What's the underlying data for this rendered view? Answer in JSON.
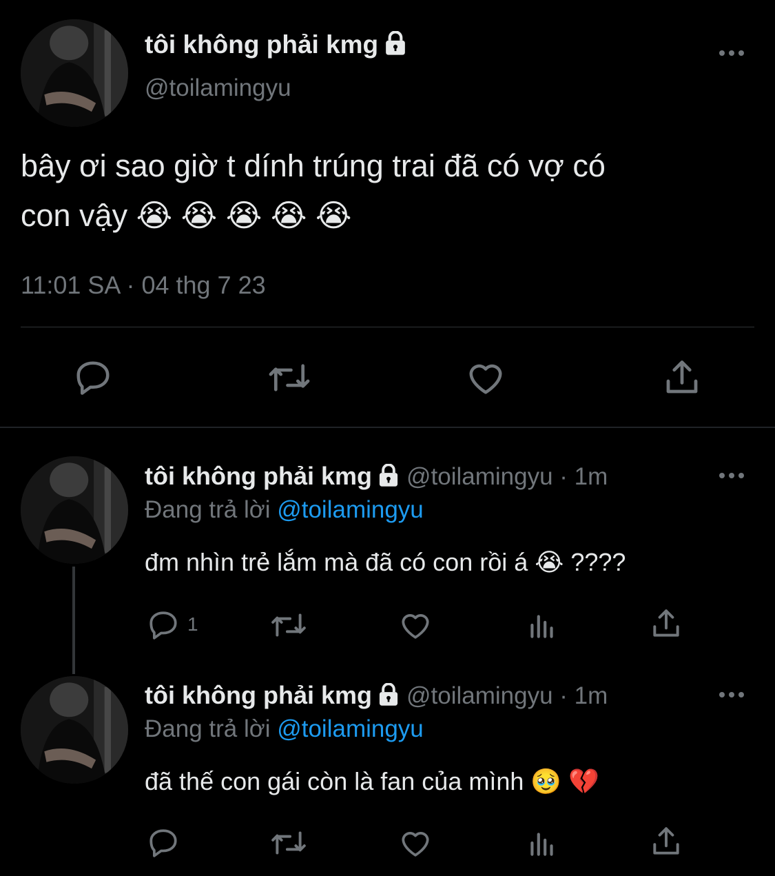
{
  "main_tweet": {
    "display_name": "tôi không phải kmg",
    "handle": "@toilamingyu",
    "text_line1": "bây ơi sao giờ t dính trúng trai đã có vợ có",
    "text_line2": "con vậy 😭 😭 😭 😭 😭",
    "timestamp": "11:01 SA · 04 thg 7 23"
  },
  "replies": [
    {
      "display_name": "tôi không phải kmg",
      "handle_time": "@toilamingyu · 1m",
      "replying_prefix": "Đang trả lời",
      "replying_to": "@toilamingyu",
      "text": "đm nhìn trẻ lắm mà đã có con rồi á 😭 ????",
      "reply_count": "1"
    },
    {
      "display_name": "tôi không phải kmg",
      "handle_time": "@toilamingyu · 1m",
      "replying_prefix": "Đang trả lời",
      "replying_to": "@toilamingyu",
      "text": "đã thế con gái còn là fan của mình 🥹 💔",
      "reply_count": ""
    }
  ],
  "colors": {
    "background": "#000000",
    "text": "#e7e9ea",
    "muted": "#71767b",
    "accent": "#1d9bf0",
    "divider": "#2f3336"
  },
  "icons": [
    "lock-icon",
    "more-icon",
    "reply-icon",
    "retweet-icon",
    "like-icon",
    "share-icon",
    "views-icon"
  ]
}
